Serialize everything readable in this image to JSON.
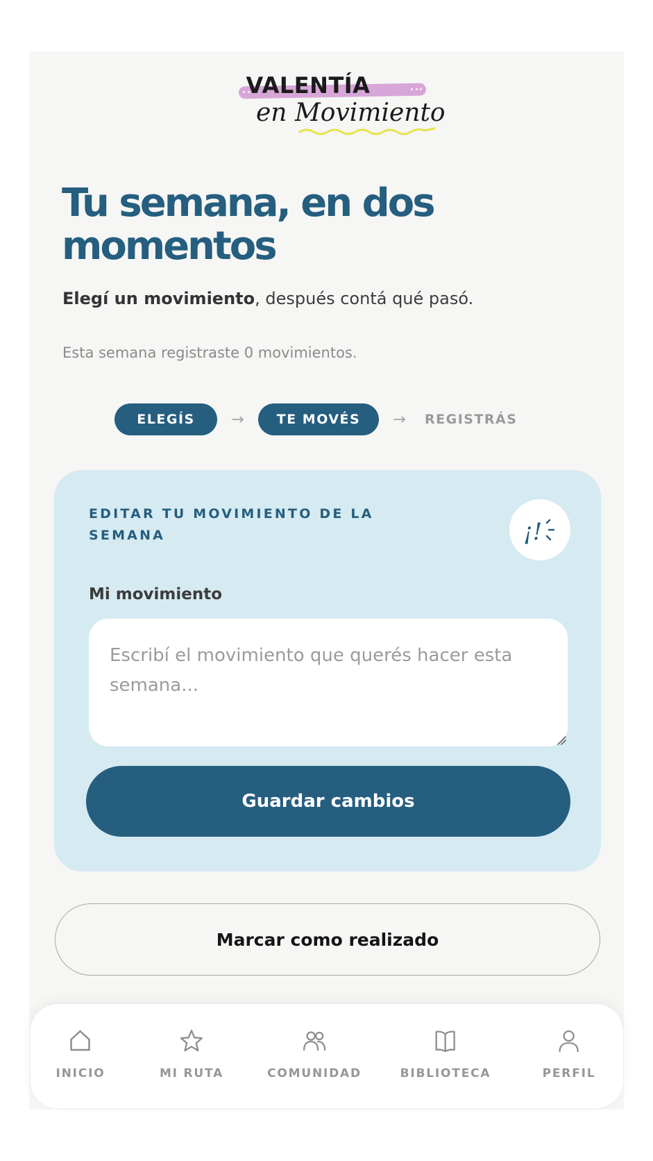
{
  "logo": {
    "line1": "VALENTÍA",
    "line2": "en Movimiento",
    "colors": {
      "swash": "#d7a6d8",
      "squiggle": "#e7e24a",
      "text": "#1b1b1b"
    }
  },
  "page": {
    "title": "Tu semana, en dos momentos",
    "subtitle_bold": "Elegí un movimiento",
    "subtitle_rest": ", después contá qué pasó.",
    "weekly_count_text": "Esta semana registraste 0 movimientos."
  },
  "steps": {
    "items": [
      {
        "label": "ELEGÍS",
        "state": "active"
      },
      {
        "label": "TE MOVÉS",
        "state": "active"
      },
      {
        "label": "REGISTRÁS",
        "state": "pending"
      }
    ],
    "arrow_icon": "arrow-right-icon"
  },
  "edit_card": {
    "heading": "EDITAR TU MOVIMIENTO DE LA SEMANA",
    "badge_icon": "exclamation-burst-icon",
    "badge_text": "¡!",
    "field_label": "Mi movimiento",
    "field_value": "",
    "field_placeholder": "Escribí el movimiento que querés hacer esta semana...",
    "save_label": "Guardar cambios"
  },
  "mark_done_label": "Marcar como realizado",
  "bottom_nav": {
    "items": [
      {
        "label": "INICIO",
        "icon": "home-icon"
      },
      {
        "label": "MI RUTA",
        "icon": "star-icon"
      },
      {
        "label": "COMUNIDAD",
        "icon": "users-icon"
      },
      {
        "label": "BIBLIOTECA",
        "icon": "book-icon"
      },
      {
        "label": "PERFIL",
        "icon": "user-icon"
      }
    ]
  },
  "colors": {
    "primary": "#255e7f",
    "card_background": "#d6eaf2",
    "page_background": "#f6f6f4",
    "muted_text": "#979797"
  }
}
